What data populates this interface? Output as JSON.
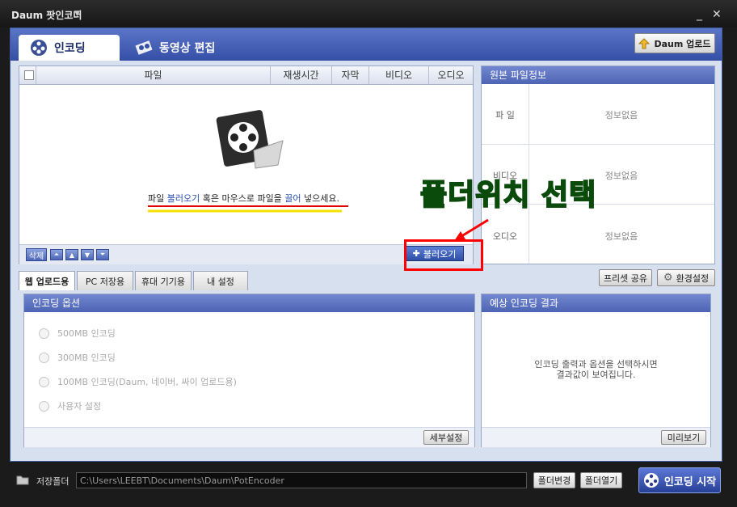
{
  "window": {
    "title": "Daum 팟인코더"
  },
  "main_tabs": [
    {
      "label": "인코딩"
    },
    {
      "label": "동영상 편집"
    }
  ],
  "toolbar": {
    "upload_label": "Daum 업로드"
  },
  "file_list": {
    "columns": [
      "파일",
      "재생시간",
      "자막",
      "비디오",
      "오디오"
    ],
    "drop_hint_prefix": "파일 ",
    "drop_hint_link1": "불러오기",
    "drop_hint_middle": " 혹은 마우스로 파일을 ",
    "drop_hint_link2": "끌어",
    "drop_hint_suffix": " 넣으세요.",
    "delete_label": "삭제",
    "load_label": "불러오기"
  },
  "annotation": {
    "text": "폴더위치 선택"
  },
  "info_panel": {
    "title": "원본 파일정보",
    "rows": [
      {
        "label": "파  일",
        "value": "정보없음"
      },
      {
        "label": "비디오",
        "value": "정보없음"
      },
      {
        "label": "오디오",
        "value": "정보없음"
      }
    ]
  },
  "sub_tabs": [
    "웹 업로드용",
    "PC 저장용",
    "휴대 기기용",
    "내 설정"
  ],
  "preset_share_label": "프리셋 공유",
  "settings_label": "환경설정",
  "options_panel": {
    "title": "인코딩 옵션",
    "options": [
      "500MB 인코딩",
      "300MB 인코딩",
      "100MB 인코딩(Daum, 네이버, 싸이 업로드용)",
      "사용자 설정"
    ],
    "detail_label": "세부설정"
  },
  "result_panel": {
    "title": "예상 인코딩 결과",
    "message_line1": "인코딩 출력과 옵션을 선택하시면",
    "message_line2": "결과값이 보여집니다.",
    "preview_label": "미리보기"
  },
  "bottom": {
    "save_folder_label": "저장폴더",
    "save_path": "C:\\Users\\LEEBT\\Documents\\Daum\\PotEncoder",
    "change_folder_label": "폴더변경",
    "open_folder_label": "폴더열기",
    "start_label": "인코딩 시작"
  },
  "colors": {
    "accent": "#3a55ae",
    "annotation": "#1ecb23",
    "highlight": "#ff0000"
  }
}
